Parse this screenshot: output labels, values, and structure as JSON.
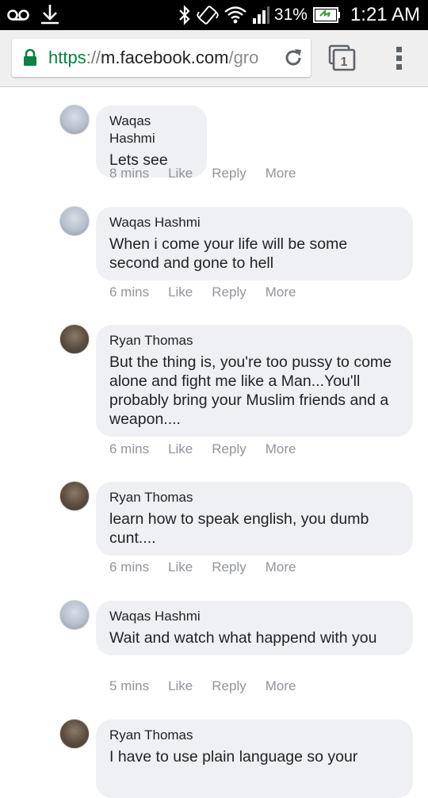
{
  "status_bar": {
    "voicemail_icon": "voicemail-icon",
    "download_icon": "download-icon",
    "bluetooth_icon": "bluetooth-icon",
    "vibrate_icon": "vibrate-icon",
    "wifi_icon": "wifi-icon",
    "signal_icon": "signal-icon",
    "battery_percent": "31%",
    "battery_icon": "battery-charging-icon",
    "time": "1:21 AM"
  },
  "browser": {
    "url_scheme": "https",
    "url_sep": "://",
    "url_host": "m.facebook.com",
    "url_path": "/gro",
    "tab_count": "1",
    "lock_icon": "lock-icon",
    "reload_icon": "reload-icon",
    "menu_icon": "overflow-menu-icon"
  },
  "actions": {
    "like": "Like",
    "reply": "Reply",
    "more": "More"
  },
  "comments": [
    {
      "author": "Waqas Hashmi",
      "text": "Lets see",
      "time": "8 mins"
    },
    {
      "author": "Waqas Hashmi",
      "text": "When i come your life will be some second and gone to hell",
      "time": "6 mins"
    },
    {
      "author": "Ryan Thomas",
      "text": "But the thing is, you're too pussy to come alone and fight me like a Man...You'll probably bring your Muslim friends and a weapon....",
      "time": "6 mins"
    },
    {
      "author": "Ryan Thomas",
      "text": "learn how to speak english, you dumb cunt....",
      "time": "6 mins"
    },
    {
      "author": "Waqas Hashmi",
      "text": "Wait and watch what happend with you",
      "time": "5 mins"
    },
    {
      "author": "Ryan Thomas",
      "text": "I have to use plain language so your",
      "time": ""
    }
  ]
}
